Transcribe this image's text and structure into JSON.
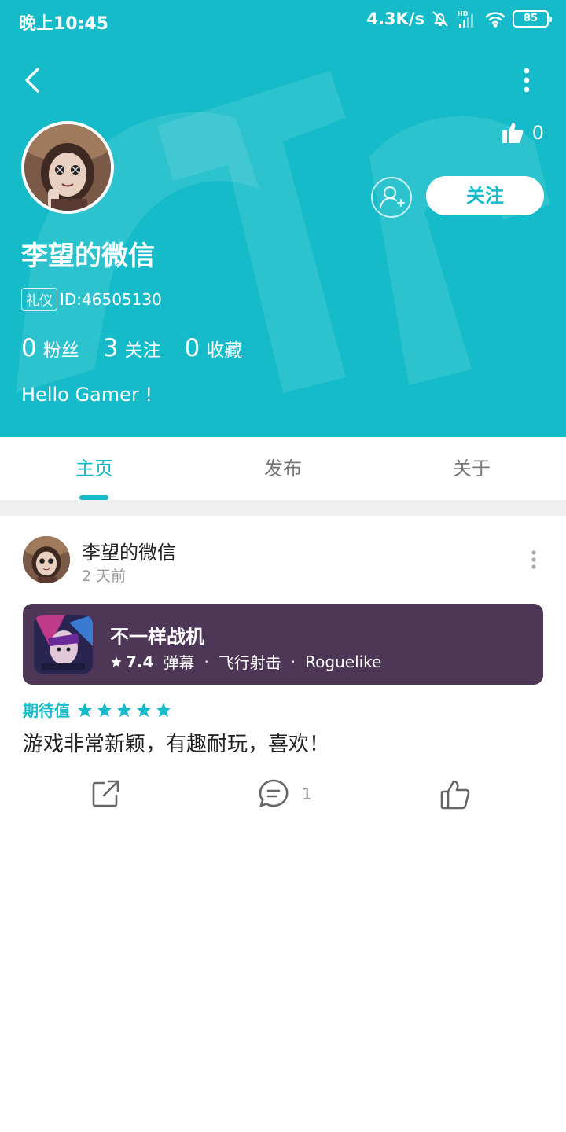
{
  "status_bar": {
    "time": "晚上10:45",
    "speed": "4.3K/s",
    "battery": "85"
  },
  "profile": {
    "likes": "0",
    "follow_label": "关注",
    "username": "李望的微信",
    "id_tag": "礼仪",
    "id_text": "ID:46505130",
    "stats": [
      {
        "value": "0",
        "label": "粉丝"
      },
      {
        "value": "3",
        "label": "关注"
      },
      {
        "value": "0",
        "label": "收藏"
      }
    ],
    "bio": "Hello Gamer !"
  },
  "tabs": [
    {
      "label": "主页",
      "active": true
    },
    {
      "label": "发布",
      "active": false
    },
    {
      "label": "关于",
      "active": false
    }
  ],
  "post": {
    "author": "李望的微信",
    "time": "2 天前",
    "game": {
      "title": "不一样战机",
      "score": "7.4",
      "tags": [
        "弹幕",
        "飞行射击",
        "Roguelike"
      ]
    },
    "rating_label": "期待值",
    "rating_stars": 5,
    "text": "游戏非常新颖，有趣耐玩，喜欢！",
    "comment_count": "1"
  },
  "colors": {
    "accent": "#15bbc9",
    "card_bg": "#4d3656"
  }
}
